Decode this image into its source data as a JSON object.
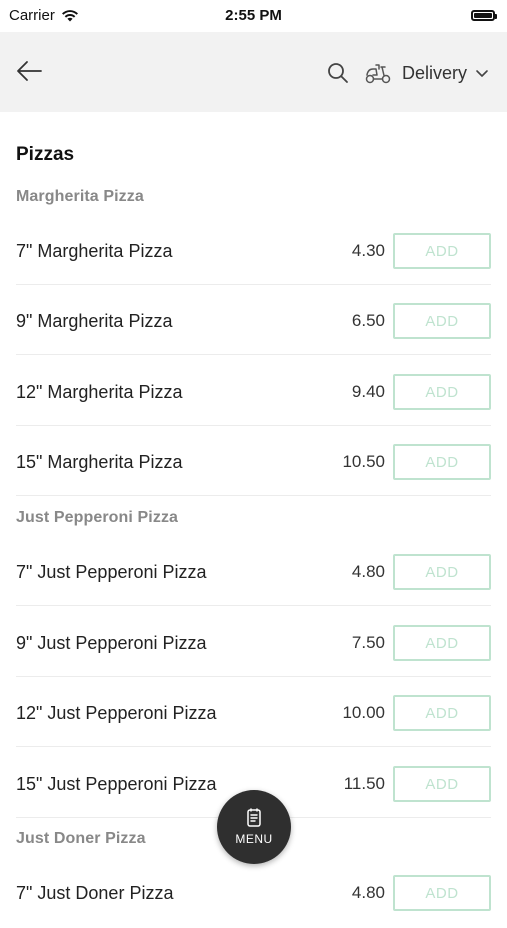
{
  "status_bar": {
    "carrier": "Carrier",
    "time": "2:55 PM"
  },
  "nav": {
    "delivery_label": "Delivery"
  },
  "section_title": "Pizzas",
  "categories": [
    "Margherita Pizza",
    "Just Pepperoni Pizza",
    "Just Doner Pizza"
  ],
  "items": [
    {
      "name": "7\" Margherita Pizza",
      "price": "4.30",
      "add_label": "ADD"
    },
    {
      "name": "9\" Margherita Pizza",
      "price": "6.50",
      "add_label": "ADD"
    },
    {
      "name": "12\" Margherita Pizza",
      "price": "9.40",
      "add_label": "ADD"
    },
    {
      "name": "15\" Margherita Pizza",
      "price": "10.50",
      "add_label": "ADD"
    },
    {
      "name": "7\" Just Pepperoni Pizza",
      "price": "4.80",
      "add_label": "ADD"
    },
    {
      "name": "9\" Just Pepperoni Pizza",
      "price": "7.50",
      "add_label": "ADD"
    },
    {
      "name": "12\" Just Pepperoni Pizza",
      "price": "10.00",
      "add_label": "ADD"
    },
    {
      "name": "15\" Just Pepperoni Pizza",
      "price": "11.50",
      "add_label": "ADD"
    },
    {
      "name": "7\" Just Doner Pizza",
      "price": "4.80",
      "add_label": "ADD"
    }
  ],
  "fab": {
    "label": "MENU"
  },
  "colors": {
    "nav_bg": "#f2f2f2",
    "add_accent": "#bfe3cf",
    "fab_bg": "#2f2f2f"
  },
  "icons": [
    "back-arrow-icon",
    "search-icon",
    "scooter-icon",
    "chevron-down-icon",
    "menu-book-icon",
    "wifi-icon",
    "battery-icon"
  ]
}
